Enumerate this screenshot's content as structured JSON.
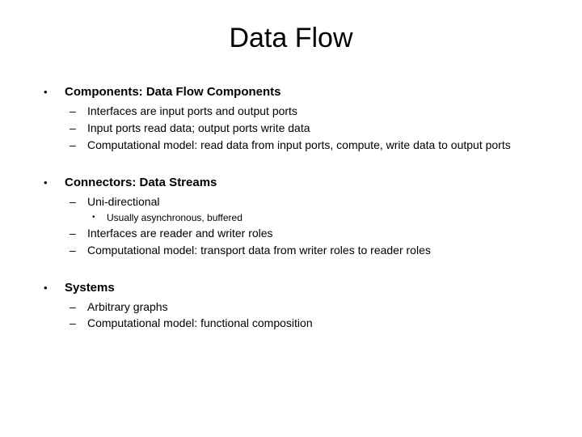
{
  "title": "Data Flow",
  "sections": [
    {
      "heading": "Components: Data Flow Components",
      "items": [
        {
          "text": "Interfaces are input ports and output ports"
        },
        {
          "text": "Input ports read data; output ports write data"
        },
        {
          "text": "Computational model: read data from input ports, compute, write data to output ports"
        }
      ]
    },
    {
      "heading": "Connectors: Data Streams",
      "items": [
        {
          "text": "Uni-directional",
          "sub": [
            {
              "text": "Usually asynchronous, buffered"
            }
          ]
        },
        {
          "text": "Interfaces are reader and writer roles"
        },
        {
          "text": "Computational model: transport data from writer roles to reader roles"
        }
      ]
    },
    {
      "heading": "Systems",
      "items": [
        {
          "text": "Arbitrary graphs"
        },
        {
          "text": "Computational model: functional composition"
        }
      ]
    }
  ]
}
